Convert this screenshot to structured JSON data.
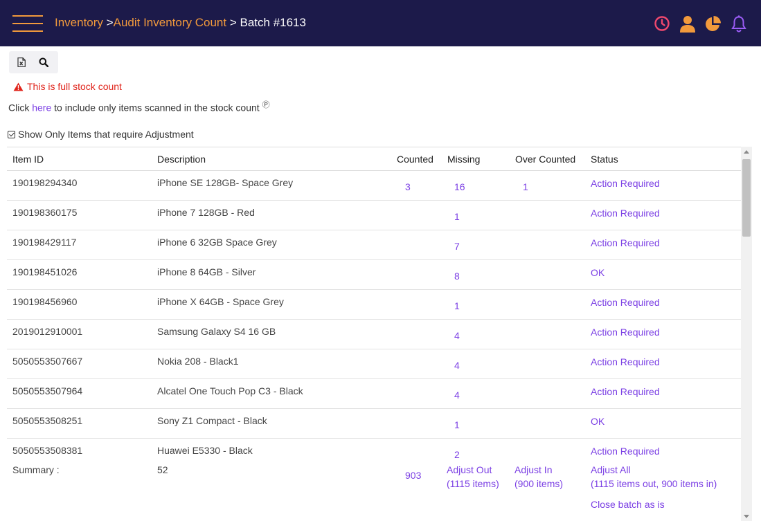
{
  "header": {
    "breadcrumb": [
      {
        "label": "Inventory",
        "link": true
      },
      {
        "label": "Audit Inventory Count",
        "link": true
      },
      {
        "label": "Batch #1613",
        "link": false
      }
    ],
    "separator": ">",
    "icons": [
      "clock-icon",
      "user-icon",
      "pie-chart-icon",
      "bell-icon"
    ],
    "colors": {
      "bar": "#1c1a4a",
      "accent": "#f29a3c",
      "clock": "#f0486e",
      "bell": "#9b5cf6"
    }
  },
  "toolbar": {
    "icons": [
      "excel-export-icon",
      "search-icon"
    ]
  },
  "warning": {
    "text": "This is full stock count",
    "color": "#e0241b"
  },
  "hint": {
    "prefix": "Click ",
    "link": "here",
    "suffix": " to include only items scanned in the stock count"
  },
  "filter": {
    "label": "Show Only Items that require Adjustment",
    "checked": true
  },
  "table": {
    "columns": [
      "Item ID",
      "Description",
      "Counted",
      "Missing",
      "Over Counted",
      "Status"
    ],
    "rows": [
      {
        "id": "190198294340",
        "desc": "iPhone SE 128GB- Space Grey",
        "counted": "3",
        "missing": "16",
        "over": "1",
        "status": "Action Required"
      },
      {
        "id": "190198360175",
        "desc": "iPhone 7 128GB - Red",
        "counted": "",
        "missing": "1",
        "over": "",
        "status": "Action Required"
      },
      {
        "id": "190198429117",
        "desc": "iPhone 6 32GB Space Grey",
        "counted": "",
        "missing": "7",
        "over": "",
        "status": "Action Required"
      },
      {
        "id": "190198451026",
        "desc": "iPhone 8 64GB - Silver",
        "counted": "",
        "missing": "8",
        "over": "",
        "status": "OK"
      },
      {
        "id": "190198456960",
        "desc": "iPhone X 64GB - Space Grey",
        "counted": "",
        "missing": "1",
        "over": "",
        "status": "Action Required"
      },
      {
        "id": "2019012910001",
        "desc": "Samsung Galaxy S4 16 GB",
        "counted": "",
        "missing": "4",
        "over": "",
        "status": "Action Required"
      },
      {
        "id": "5050553507667",
        "desc": "Nokia 208 - Black1",
        "counted": "",
        "missing": "4",
        "over": "",
        "status": "Action Required"
      },
      {
        "id": "5050553507964",
        "desc": "Alcatel One Touch Pop C3 - Black",
        "counted": "",
        "missing": "4",
        "over": "",
        "status": "Action Required"
      },
      {
        "id": "5050553508251",
        "desc": "Sony Z1 Compact - Black",
        "counted": "",
        "missing": "1",
        "over": "",
        "status": "OK"
      },
      {
        "id": "5050553508381",
        "desc": "Huawei E5330 - Black",
        "counted": "",
        "missing": "2",
        "over": "",
        "status": "Action Required"
      }
    ],
    "link_color": "#7b3fe4"
  },
  "summary": {
    "label": "Summary :",
    "items": "52",
    "counted": "903",
    "adjust_out": {
      "line1": "Adjust Out",
      "line2": "(1115 items)"
    },
    "adjust_in": {
      "line1": "Adjust In",
      "line2": "(900 items)"
    },
    "adjust_all": {
      "line1": "Adjust All",
      "line2": "(1115 items out, 900 items in)"
    },
    "close_batch": "Close batch as is"
  }
}
